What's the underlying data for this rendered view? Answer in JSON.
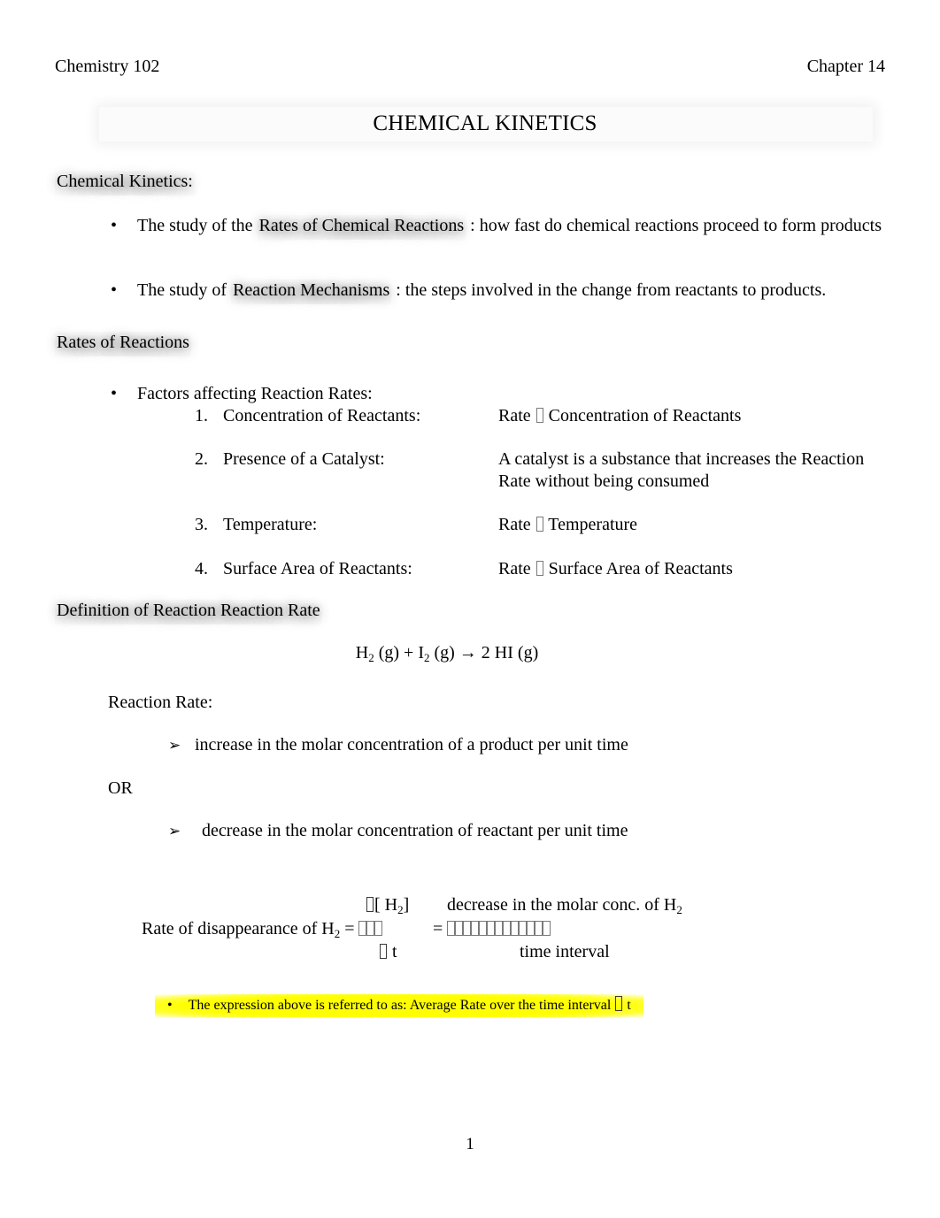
{
  "header": {
    "left": "Chemistry 102",
    "right": "Chapter 14",
    "title": "CHEMICAL KINETICS"
  },
  "sections": {
    "kinetics_heading": "Chemical Kinetics:",
    "rates_heading": "Rates of Reactions",
    "definition_heading": "Definition of Reaction Reaction Rate"
  },
  "kinetics_bullets": [
    {
      "marker": "•",
      "term": "Rates of Chemical Reactions",
      "pre": "The study of the ",
      "post": " :  how fast do chemical reactions proceed to form products"
    },
    {
      "marker": "•",
      "term": "Reaction Mechanisms",
      "pre": "The study of ",
      "post": " :  the steps involved in the change from reactants to products."
    }
  ],
  "factors": {
    "marker": "•",
    "heading": "Factors affecting Reaction Rates:",
    "items": [
      {
        "number": "1.",
        "label": "Concentration of Reactants:",
        "desc_pre": "Rate ",
        "desc_post": " Concentration of Reactants"
      },
      {
        "number": "2.",
        "label": "Presence of a Catalyst:",
        "desc_pre": "A catalyst is a substance that increases the Reaction Rate without being consumed",
        "desc_post": ""
      },
      {
        "number": "3.",
        "label": "Temperature:",
        "desc_pre": "Rate ",
        "desc_post": " Temperature"
      },
      {
        "number": "4.",
        "label": "Surface Area of Reactants:",
        "desc_pre": "Rate ",
        "desc_post": " Surface Area of Reactants"
      }
    ]
  },
  "equation": {
    "h2": "H",
    "h2_sub": "2",
    "gas1": " (g)  +  ",
    "i2": "I",
    "i2_sub": "2",
    "gas2": " (g)   →   2 HI (g)"
  },
  "reaction_rate": {
    "heading": "Reaction Rate:",
    "arrow_marker": "➢",
    "line1": "increase in the molar concentration of a product per unit time",
    "or": "OR",
    "line2": "decrease in the molar concentration of reactant per unit time"
  },
  "rate_expression": {
    "numerator_bracket": "[ H",
    "numerator_sub": "2",
    "numerator_close": "]",
    "numerator_right": "decrease in the molar conc. of H",
    "numerator_right_sub": "2",
    "left_label_a": "Rate of disappearance of H",
    "left_label_sub": "2",
    "left_label_b": " = ",
    "equals": "=",
    "denominator_left": "t",
    "denominator_right": "time interval"
  },
  "highlight_note": {
    "marker": "•",
    "text_pre": "The expression above is referred to as: Average Rate over the time interval ",
    "text_post": " t",
    "color": "#ffff00"
  },
  "footer": {
    "page_number": "1"
  }
}
